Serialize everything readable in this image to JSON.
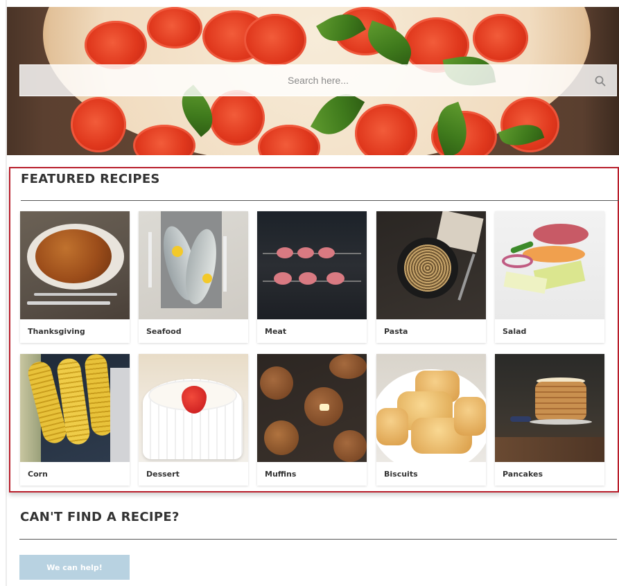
{
  "search": {
    "placeholder": "Search here..."
  },
  "featured": {
    "title": "FEATURED RECIPES",
    "recipes": [
      {
        "label": "Thanksgiving"
      },
      {
        "label": "Seafood"
      },
      {
        "label": "Meat"
      },
      {
        "label": "Pasta"
      },
      {
        "label": "Salad"
      },
      {
        "label": "Corn"
      },
      {
        "label": "Dessert"
      },
      {
        "label": "Muffins"
      },
      {
        "label": "Biscuits"
      },
      {
        "label": "Pancakes"
      }
    ]
  },
  "help": {
    "title": "CAN'T FIND A RECIPE?",
    "button_label": "We can help!"
  },
  "colors": {
    "accent_border": "#b81d2a",
    "button_bg": "#b8d2e1",
    "text": "#333333"
  }
}
